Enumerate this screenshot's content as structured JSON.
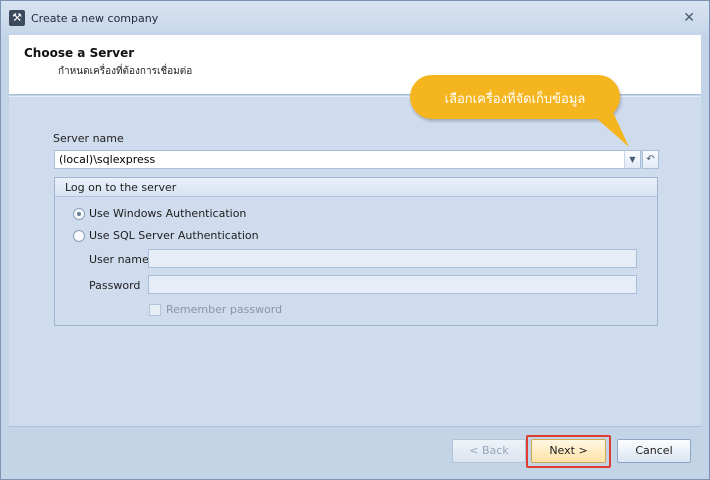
{
  "window": {
    "title": "Create a new company",
    "app_icon_glyph": "⚒",
    "close_glyph": "✕"
  },
  "header": {
    "title": "Choose a Server",
    "subtitle": "กำหนดเครื่องที่ต้องการเชื่อมต่อ"
  },
  "callout": {
    "text": "เลือกเครื่องที่จัดเก็บข้อมูล",
    "color": "#f5b51e"
  },
  "server": {
    "label": "Server name",
    "value": "(local)\\sqlexpress",
    "dropdown_glyph": "▼",
    "refresh_glyph": "↶"
  },
  "logon": {
    "group_title": "Log on to the server",
    "windows_auth_label": "Use Windows Authentication",
    "sql_auth_label": "Use SQL Server Authentication",
    "selected": "windows",
    "username_label": "User name",
    "username_value": "",
    "password_label": "Password",
    "password_value": "",
    "remember_label": "Remember password",
    "remember_checked": false
  },
  "footer": {
    "back_label": "< Back",
    "next_label": "Next >",
    "cancel_label": "Cancel",
    "highlight_color": "#e03c31"
  }
}
